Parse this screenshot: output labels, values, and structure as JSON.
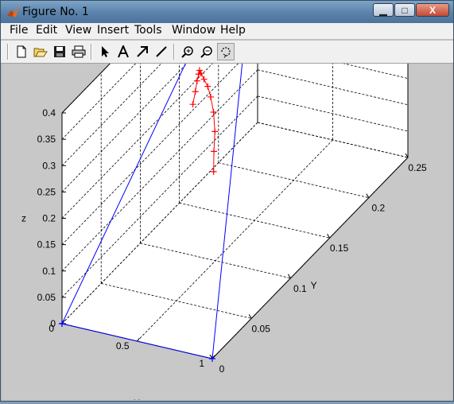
{
  "window": {
    "title": "Figure No. 1",
    "buttons": {
      "minimize": "▁",
      "maximize": "□",
      "close": "X"
    }
  },
  "menu": {
    "items": [
      "File",
      "Edit",
      "View",
      "Insert",
      "Tools",
      "Window",
      "Help"
    ]
  },
  "toolbar": {
    "tools": [
      {
        "icon": "new-figure-icon"
      },
      {
        "icon": "open-folder-icon"
      },
      {
        "icon": "save-icon"
      },
      {
        "icon": "print-icon"
      },
      {
        "icon": "arrow-select-icon"
      },
      {
        "icon": "insert-text-icon"
      },
      {
        "icon": "insert-arrow-icon"
      },
      {
        "icon": "insert-line-icon"
      },
      {
        "icon": "zoom-in-icon"
      },
      {
        "icon": "zoom-out-icon"
      },
      {
        "icon": "rotate-3d-icon",
        "pressed": true
      }
    ]
  },
  "chart_data": {
    "type": "line",
    "view": "3d",
    "grid": true,
    "xlabel": "X",
    "ylabel": "Y",
    "zlabel": "z",
    "xlim": [
      0,
      1
    ],
    "ylim": [
      0,
      0.25
    ],
    "zlim": [
      0,
      0.4
    ],
    "x_ticks": [
      "0",
      "0.5",
      "1"
    ],
    "y_ticks": [
      "0",
      "0.05",
      "0.1",
      "0.15",
      "0.2",
      "0.25"
    ],
    "z_ticks": [
      "0",
      "0.05",
      "0.1",
      "0.15",
      "0.2",
      "0.25",
      "0.3",
      "0.35",
      "0.4"
    ],
    "series": [
      {
        "color": "#0000ff",
        "marker": "+",
        "x": [
          0,
          1,
          0,
          0
        ],
        "y": [
          0,
          0,
          0.25,
          0
        ],
        "z": [
          0,
          0,
          0.4,
          0
        ]
      },
      {
        "color": "#ff0000",
        "marker": "+",
        "x": [
          0.41,
          0.36,
          0.33,
          0.29,
          0.25,
          0.22,
          0.19,
          0.17,
          0.16,
          0.17,
          0.18,
          0.2,
          0.22
        ],
        "y": [
          0.115,
          0.125,
          0.132,
          0.138,
          0.142,
          0.144,
          0.145,
          0.145,
          0.145,
          0.142,
          0.138,
          0.132,
          0.125
        ],
        "z": [
          0.14,
          0.16,
          0.185,
          0.21,
          0.23,
          0.245,
          0.255,
          0.265,
          0.27,
          0.268,
          0.262,
          0.252,
          0.24
        ]
      }
    ]
  }
}
